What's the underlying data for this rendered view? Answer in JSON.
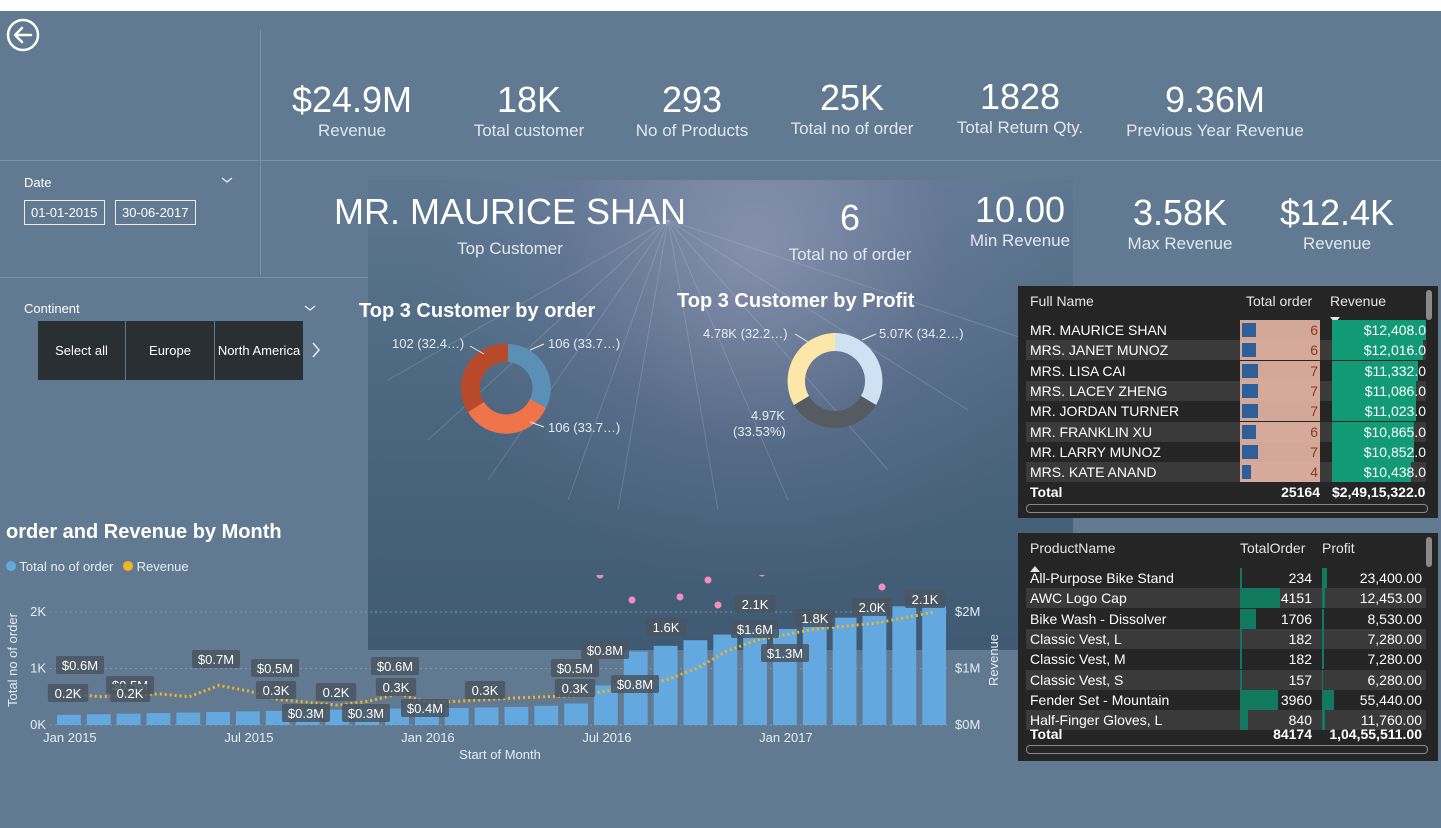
{
  "kpis_top": [
    {
      "value": "$24.9M",
      "label": "Revenue"
    },
    {
      "value": "18K",
      "label": "Total customer"
    },
    {
      "value": "293",
      "label": "No of Products"
    },
    {
      "value": "25K",
      "label": "Total no of order"
    },
    {
      "value": "1828",
      "label": "Total Return Qty."
    },
    {
      "value": "9.36M",
      "label": "Previous Year Revenue"
    }
  ],
  "kpis_mid": {
    "top_customer": {
      "value": "MR. MAURICE SHAN",
      "label": "Top Customer"
    },
    "orders": {
      "value": "6",
      "label": "Total no of order"
    },
    "min_rev": {
      "value": "10.00",
      "label": "Min Revenue"
    },
    "max_rev": {
      "value": "3.58K",
      "label": "Max Revenue"
    },
    "revenue": {
      "value": "$12.4K",
      "label": "Revenue"
    }
  },
  "date_slicer": {
    "title": "Date",
    "start": "01-01-2015",
    "end": "30-06-2017"
  },
  "continent_slicer": {
    "title": "Continent",
    "options": [
      "Select all",
      "Europe",
      "North America"
    ]
  },
  "donut_orders": {
    "title": "Top 3 Customer by order",
    "labels": [
      "102 (32.4…)",
      "106 (33.7…)",
      "106 (33.7…)"
    ],
    "colors": [
      "#b84a2b",
      "#5b8fb5",
      "#f0744a"
    ]
  },
  "donut_profit": {
    "title": "Top 3 Customer by Profit",
    "labels": [
      "4.78K (32.2…)",
      "5.07K (34.2…)",
      "4.97K",
      "(33.53%)"
    ],
    "colors": [
      "#fde7a8",
      "#cfe2f3",
      "#555b60"
    ]
  },
  "customer_table": {
    "headers": [
      "Full Name",
      "Total order",
      "Revenue"
    ],
    "rows": [
      {
        "name": "MR. MAURICE SHAN",
        "orders": "6",
        "rev": "$12,408.0"
      },
      {
        "name": "MRS. JANET MUNOZ",
        "orders": "6",
        "rev": "$12,016.0"
      },
      {
        "name": "MRS. LISA CAI",
        "orders": "7",
        "rev": "$11,332.0"
      },
      {
        "name": "MRS. LACEY ZHENG",
        "orders": "7",
        "rev": "$11,086.0"
      },
      {
        "name": "MR. JORDAN TURNER",
        "orders": "7",
        "rev": "$11,023.0"
      },
      {
        "name": "MR. FRANKLIN XU",
        "orders": "6",
        "rev": "$10,865.0"
      },
      {
        "name": "MR. LARRY MUNOZ",
        "orders": "7",
        "rev": "$10,852.0"
      },
      {
        "name": "MRS. KATE ANAND",
        "orders": "4",
        "rev": "$10,438.0"
      }
    ],
    "total": {
      "label": "Total",
      "orders": "25164",
      "rev": "$2,49,15,322.0"
    }
  },
  "product_table": {
    "headers": [
      "ProductName",
      "TotalOrder",
      "Profit"
    ],
    "rows": [
      {
        "name": "All-Purpose Bike Stand",
        "orders": "234",
        "profit": "23,400.00"
      },
      {
        "name": "AWC Logo Cap",
        "orders": "4151",
        "profit": "12,453.00"
      },
      {
        "name": "Bike Wash - Dissolver",
        "orders": "1706",
        "profit": "8,530.00"
      },
      {
        "name": "Classic Vest, L",
        "orders": "182",
        "profit": "7,280.00"
      },
      {
        "name": "Classic Vest, M",
        "orders": "182",
        "profit": "7,280.00"
      },
      {
        "name": "Classic Vest, S",
        "orders": "157",
        "profit": "6,280.00"
      },
      {
        "name": "Fender Set - Mountain",
        "orders": "3960",
        "profit": "55,440.00"
      },
      {
        "name": "Half-Finger Gloves, L",
        "orders": "840",
        "profit": "11,760.00"
      }
    ],
    "total": {
      "label": "Total",
      "orders": "84174",
      "profit": "1,04,55,511.00"
    }
  },
  "combo_chart": {
    "title": "order and Revenue by Month",
    "legend": [
      "Total no of order",
      "Revenue"
    ],
    "y_left_label": "Total no of order",
    "y_right_label": "Revenue",
    "x_label": "Start of Month",
    "y_left_ticks": [
      "0K",
      "1K",
      "2K"
    ],
    "y_right_ticks": [
      "$0M",
      "$1M",
      "$2M"
    ],
    "x_ticks": [
      "Jan 2015",
      "Jul 2015",
      "Jan 2016",
      "Jul 2016",
      "Jan 2017"
    ],
    "data_labels": [
      "$0.6M",
      "0.2K",
      "$0.5M",
      "0.2K",
      "$0.7M",
      "$0.5M",
      "0.3K",
      "$0.3M",
      "0.2K",
      "$0.3M",
      "$0.6M",
      "0.3K",
      "$0.4M",
      "0.3K",
      "$0.5M",
      "0.3K",
      "$0.8M",
      "$0.8M",
      "1.6K",
      "2.1K",
      "$1.6M",
      "$1.3M",
      "1.8K",
      "2.0K",
      "2.1K"
    ]
  },
  "chart_data": {
    "type": "bar",
    "title": "order and Revenue by Month",
    "xlabel": "Start of Month",
    "ylabel": "Total no of order",
    "y2label": "Revenue",
    "categories": [
      "Jan 2015",
      "Feb 2015",
      "Mar 2015",
      "Apr 2015",
      "May 2015",
      "Jun 2015",
      "Jul 2015",
      "Aug 2015",
      "Sep 2015",
      "Oct 2015",
      "Nov 2015",
      "Dec 2015",
      "Jan 2016",
      "Feb 2016",
      "Mar 2016",
      "Apr 2016",
      "May 2016",
      "Jun 2016",
      "Jul 2016",
      "Aug 2016",
      "Sep 2016",
      "Oct 2016",
      "Nov 2016",
      "Dec 2016",
      "Jan 2017",
      "Feb 2017",
      "Mar 2017",
      "Apr 2017",
      "May 2017",
      "Jun 2017"
    ],
    "series": [
      {
        "name": "Total no of order",
        "axis": "left",
        "values": [
          180,
          190,
          200,
          210,
          220,
          230,
          240,
          250,
          260,
          270,
          280,
          290,
          300,
          300,
          310,
          320,
          340,
          380,
          700,
          1300,
          1400,
          1500,
          1600,
          1700,
          1700,
          1800,
          1900,
          2000,
          2100,
          2100
        ]
      },
      {
        "name": "Revenue",
        "axis": "right",
        "values": [
          0.55,
          0.5,
          0.52,
          0.55,
          0.5,
          0.7,
          0.6,
          0.45,
          0.4,
          0.35,
          0.42,
          0.55,
          0.4,
          0.42,
          0.45,
          0.48,
          0.5,
          0.52,
          0.6,
          0.7,
          0.8,
          1.0,
          1.3,
          1.5,
          1.6,
          1.7,
          1.75,
          1.8,
          1.9,
          2.0
        ]
      }
    ],
    "ylim": [
      0,
      2300
    ],
    "y2lim": [
      0,
      2.3
    ],
    "colors": {
      "bars": "#63a8df",
      "line": "#f5b325"
    },
    "legend": "top-left"
  }
}
